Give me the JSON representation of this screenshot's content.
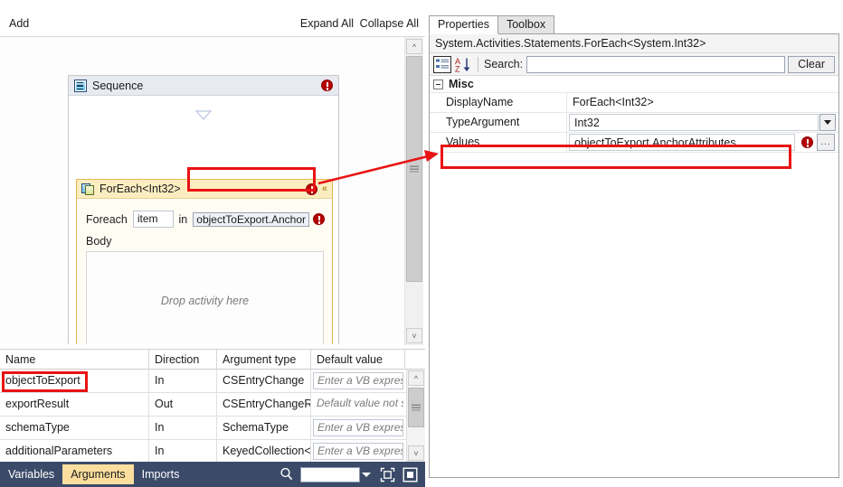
{
  "designer": {
    "toolbar": {
      "add": "Add",
      "expand_all": "Expand All",
      "collapse_all": "Collapse All"
    },
    "sequence": {
      "title": "Sequence",
      "icon": "sequence-activity-icon",
      "has_error": true
    },
    "foreach": {
      "title": "ForEach<Int32>",
      "icon": "foreach-activity-icon",
      "label_foreach": "Foreach",
      "item_variable": "item",
      "label_in": "in",
      "values_expression": "objectToExport.AnchorAttributes",
      "values_expression_visible": "objectToExport.Anchor",
      "has_error": true,
      "body_label": "Body",
      "drop_hint": "Drop activity here",
      "chevron": "«"
    }
  },
  "arguments_grid": {
    "columns": [
      "Name",
      "Direction",
      "Argument type",
      "Default value"
    ],
    "rows": [
      {
        "name": "objectToExport",
        "direction": "In",
        "type": "CSEntryChange",
        "default_value": "Enter a VB expression",
        "default_editable": true,
        "highlighted": true
      },
      {
        "name": "exportResult",
        "direction": "Out",
        "type": "CSEntryChangeResult",
        "default_value": "Default value not supported",
        "default_editable": false,
        "highlighted": false
      },
      {
        "name": "schemaType",
        "direction": "In",
        "type": "SchemaType",
        "default_value": "Enter a VB expression",
        "default_editable": true,
        "highlighted": false
      },
      {
        "name": "additionalParameters",
        "direction": "In",
        "type": "KeyedCollection<S",
        "default_value": "Enter a VB expression",
        "default_editable": true,
        "highlighted": false
      }
    ]
  },
  "status_bar": {
    "tabs": [
      {
        "label": "Variables",
        "active": false
      },
      {
        "label": "Arguments",
        "active": true
      },
      {
        "label": "Imports",
        "active": false
      }
    ],
    "search_icon": "magnifier-icon",
    "zoom_value": "",
    "zoom_caret_icon": "chevron-down-icon",
    "fit_to_screen_icon": "fit-to-screen-icon",
    "restore_icon": "restore-view-icon"
  },
  "properties": {
    "tabs": [
      {
        "label": "Properties",
        "active": true
      },
      {
        "label": "Toolbox",
        "active": false
      }
    ],
    "type_name": "System.Activities.Statements.ForEach<System.Int32>",
    "toolbar": {
      "categorized_icon": "categorized-view-icon",
      "alphabetical_icon": "alphabetical-sort-icon",
      "search_label": "Search:",
      "search_value": "",
      "clear_label": "Clear"
    },
    "group": {
      "label": "Misc",
      "expanded": true
    },
    "rows": [
      {
        "name": "DisplayName",
        "value": "ForEach<Int32>",
        "kind": "text"
      },
      {
        "name": "TypeArgument",
        "value": "Int32",
        "kind": "combo"
      },
      {
        "name": "Values",
        "value": "objectToExport.AnchorAttributes",
        "kind": "expression",
        "has_error": true,
        "ellipsis": "...",
        "highlighted": true
      }
    ]
  },
  "annotation": {
    "highlight_color": "#e81313",
    "arrow_from": "foreach-values-field",
    "arrow_to": "properties-values-row"
  }
}
